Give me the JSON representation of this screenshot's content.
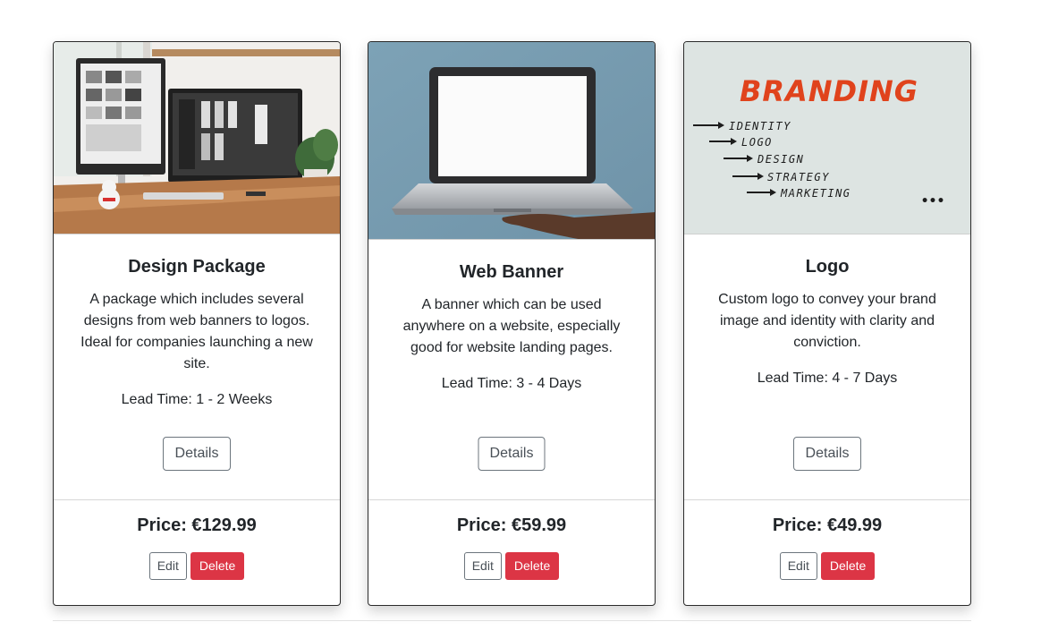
{
  "products": [
    {
      "title": "Design Package",
      "description": "A package which includes several designs from web banners to logos. Ideal for companies launching a new site.",
      "lead_time": "Lead Time: 1 - 2 Weeks",
      "details_label": "Details",
      "price": "Price: €129.99",
      "edit_label": "Edit",
      "delete_label": "Delete",
      "image": "desk-monitors-photo"
    },
    {
      "title": "Web Banner",
      "description": "A banner which can be used anywhere on a website, especially good for website landing pages.",
      "lead_time": "Lead Time: 3 - 4 Days",
      "details_label": "Details",
      "price": "Price: €59.99",
      "edit_label": "Edit",
      "delete_label": "Delete",
      "image": "laptop-held-photo"
    },
    {
      "title": "Logo",
      "description": "Custom logo to convey your brand image and identity with clarity and conviction.",
      "lead_time": "Lead Time: 4 - 7 Days",
      "details_label": "Details",
      "price": "Price: €49.99",
      "edit_label": "Edit",
      "delete_label": "Delete",
      "image": "branding-whiteboard-photo",
      "image_text": {
        "heading": "BRANDING",
        "items": [
          "IDENTITY",
          "LOGO",
          "DESIGN",
          "STRATEGY",
          "MARKETING"
        ],
        "ellipsis": "•••"
      }
    }
  ],
  "colors": {
    "danger": "#dc3545",
    "secondary": "#6c757d",
    "branding_orange": "#e0431c"
  }
}
